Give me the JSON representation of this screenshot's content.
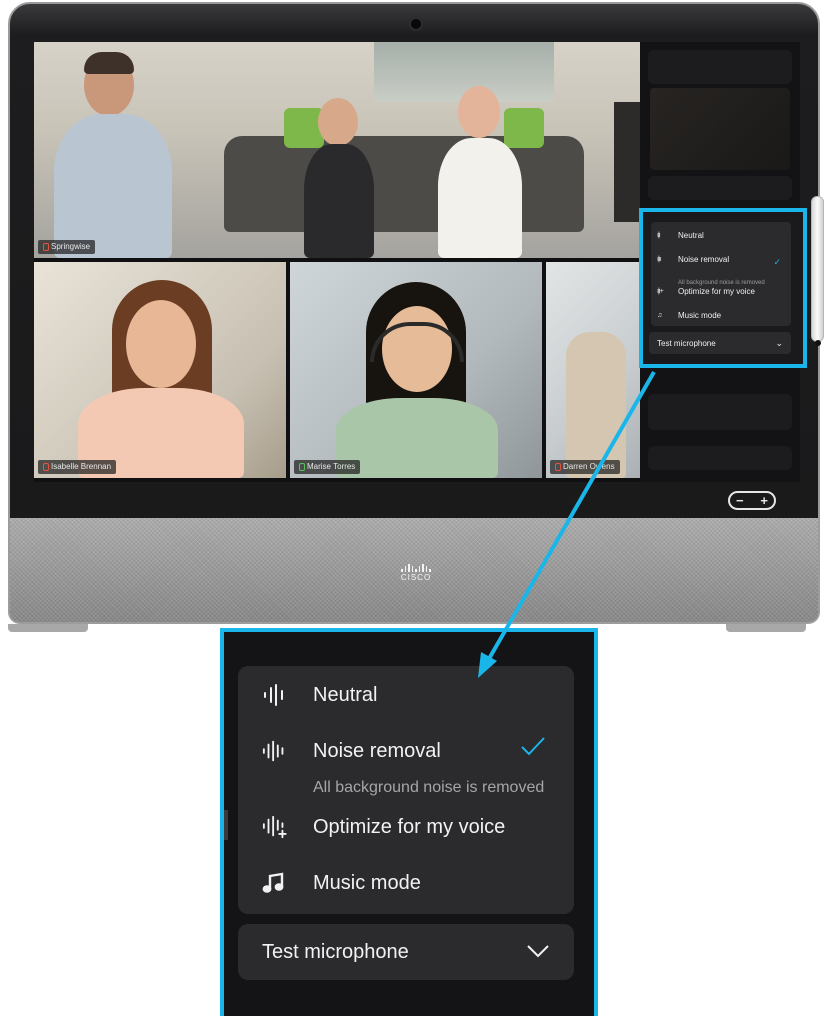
{
  "participants": [
    {
      "name": "Springwise"
    },
    {
      "name": "Isabelle Brennan"
    },
    {
      "name": "Marise Torres"
    },
    {
      "name": "Darren Owens"
    }
  ],
  "device": {
    "brand": "CISCO",
    "volume_minus": "−",
    "volume_plus": "+"
  },
  "audio_menu": {
    "items": [
      {
        "label": "Neutral",
        "icon": "audio-waveform-icon"
      },
      {
        "label": "Noise removal",
        "icon": "noise-removal-icon",
        "selected": true,
        "description": "All background noise is removed"
      },
      {
        "label": "Optimize for my voice",
        "icon": "voice-optimize-icon"
      },
      {
        "label": "Music mode",
        "icon": "music-note-icon"
      }
    ],
    "test_microphone": "Test microphone"
  },
  "colors": {
    "accent": "#1ab6ea",
    "menu_bg": "#2b2b2e",
    "panel_bg": "#141416"
  }
}
